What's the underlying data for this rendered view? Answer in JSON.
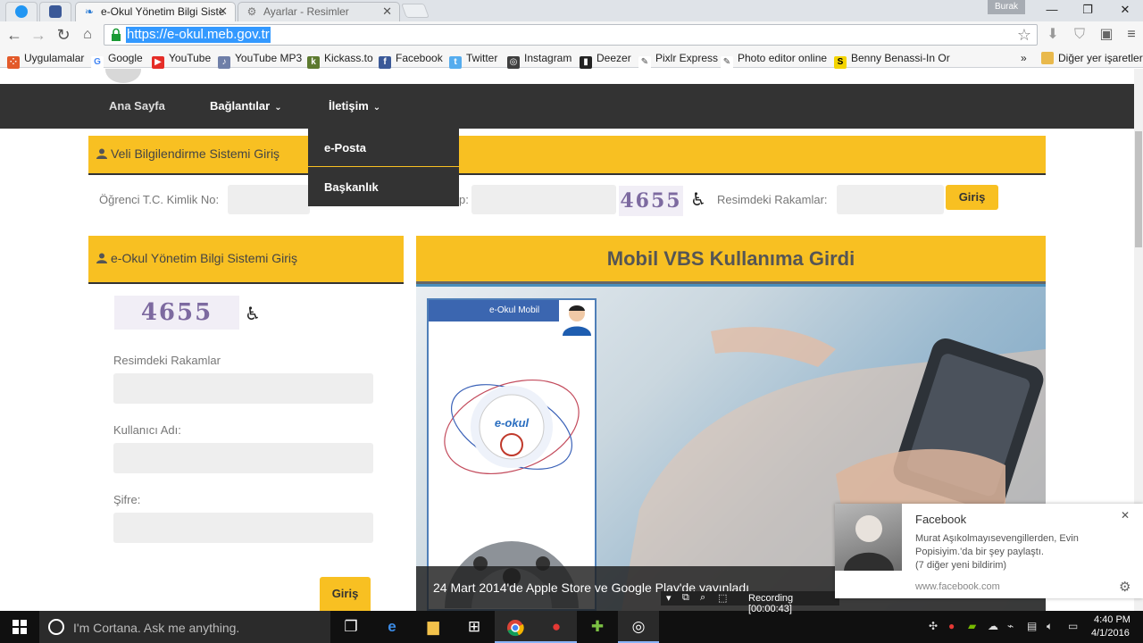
{
  "window": {
    "user": "Burak",
    "tabs": [
      {
        "title": "e-Okul Yönetim Bilgi Siste",
        "active": true
      },
      {
        "title": "Ayarlar - Resimler",
        "active": false
      }
    ],
    "url": "https://e-okul.meb.gov.tr"
  },
  "bookmarks": {
    "items": [
      "Uygulamalar",
      "Google",
      "YouTube",
      "YouTube MP3",
      "Kickass.to",
      "Facebook",
      "Twitter",
      "Instagram",
      "Deezer",
      "Pixlr Express",
      "Photo editor online",
      "Benny Benassi-In Ord"
    ],
    "more": "»",
    "other": "Diğer yer işaretleri"
  },
  "nav": {
    "home": "Ana Sayfa",
    "links": "Bağlantılar",
    "contact": "İletişim",
    "dropdown": [
      "e-Posta",
      "Başkanlık"
    ]
  },
  "veli": {
    "title": "Veli Bilgilendirme Sistemi Giriş",
    "tc_label": "Öğrenci T.C. Kimlik No:",
    "partial_label": "p:",
    "captcha": "4655",
    "captcha_label": "Resimdeki Rakamlar:",
    "submit": "Giriş"
  },
  "eokul": {
    "title": "e-Okul Yönetim Bilgi Sistemi Giriş",
    "captcha": "4655",
    "captcha_label": "Resimdeki Rakamlar",
    "user_label": "Kullanıcı Adı:",
    "password_label": "Şifre:",
    "submit": "Giriş"
  },
  "banner": {
    "title": "Mobil VBS Kullanıma Girdi",
    "card_title": "e-Okul Mobil",
    "caption": "24 Mart 2014'de Apple Store ve Google Play'de yayınladı"
  },
  "notification": {
    "app": "Facebook",
    "body_line1": "Murat Aşıkolmayısevengillerden, Evin",
    "body_line2": "Popisiyim.'da bir şey paylaştı.",
    "body_line3": "(7 diğer yeni bildirim)",
    "link": "www.facebook.com"
  },
  "recording": {
    "text": "Recording [00:00:43]"
  },
  "taskbar": {
    "cortana": "I'm Cortana. Ask me anything.",
    "time": "4:40 PM",
    "date": "4/1/2016"
  },
  "colors": {
    "accent": "#f8c022",
    "nav": "#333333",
    "url_highlight": "#3399ff"
  }
}
